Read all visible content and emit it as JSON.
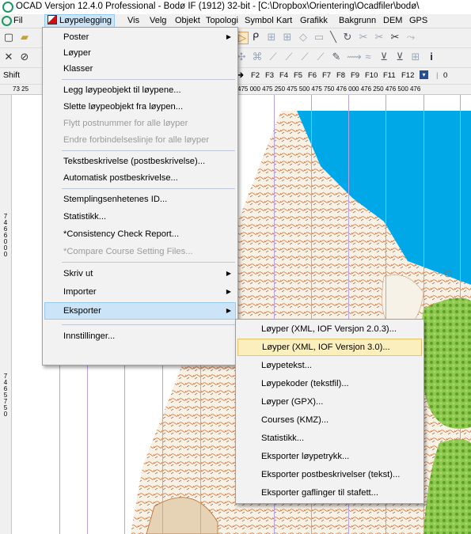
{
  "window": {
    "title": "OCAD Versjon 12.4.0  Professional - Bodø IF (1912) 32-bit - [C:\\Dropbox\\Orientering\\Ocadfiler\\bodø\\"
  },
  "menubar": {
    "items": [
      "Fil",
      "Løypelegging",
      "Vis",
      "Velg",
      "Objekt",
      "Topologi",
      "Symbol",
      "Kart",
      "Grafikk",
      "Bakgrunn",
      "DEM",
      "GPS"
    ],
    "active": "Løypelegging"
  },
  "toolbar3": {
    "shift_label": "Shift",
    "fkeys": [
      "F2",
      "F3",
      "F4",
      "F5",
      "F6",
      "F7",
      "F8",
      "F9",
      "F10",
      "F11",
      "F12"
    ],
    "zero": "0"
  },
  "ruler": {
    "top_left": "73 25",
    "top_right": "475 000 475 250 475 500 475 750 476 000 476 250 476 500 476",
    "left_1": "7466000",
    "left_2": "7465750"
  },
  "menu": {
    "items": [
      {
        "label": "Poster",
        "enabled": true,
        "submenu": true
      },
      {
        "label": "Løyper",
        "enabled": true,
        "submenu": false
      },
      {
        "label": "Klasser",
        "enabled": true,
        "submenu": false
      },
      {
        "label": "Legg løypeobjekt til løypene...",
        "enabled": true,
        "submenu": false
      },
      {
        "label": "Slette løypeobjekt fra løypen...",
        "enabled": true,
        "submenu": false
      },
      {
        "label": "Flytt postnummer for alle løyper",
        "enabled": false,
        "submenu": false
      },
      {
        "label": "Endre forbindelseslinje for alle løyper",
        "enabled": false,
        "submenu": false
      },
      {
        "label": "Tekstbeskrivelse (postbeskrivelse)...",
        "enabled": true,
        "submenu": false
      },
      {
        "label": "Automatisk postbeskrivelse...",
        "enabled": true,
        "submenu": false
      },
      {
        "label": "Stemplingsenhetenes ID...",
        "enabled": true,
        "submenu": false
      },
      {
        "label": "Statistikk...",
        "enabled": true,
        "submenu": false
      },
      {
        "label": "*Consistency Check Report...",
        "enabled": true,
        "submenu": false
      },
      {
        "label": "*Compare Course Setting Files...",
        "enabled": false,
        "submenu": false
      },
      {
        "label": "Skriv ut",
        "enabled": true,
        "submenu": true
      },
      {
        "label": "Importer",
        "enabled": true,
        "submenu": true
      },
      {
        "label": "Eksporter",
        "enabled": true,
        "submenu": true,
        "highlighted": true
      },
      {
        "label": "Innstillinger...",
        "enabled": true,
        "submenu": false
      }
    ]
  },
  "submenu": {
    "items": [
      {
        "label": "Løyper (XML, IOF Versjon 2.0.3)..."
      },
      {
        "label": "Løyper (XML, IOF Versjon 3.0)...",
        "selected": true
      },
      {
        "label": "Løypetekst..."
      },
      {
        "label": "Løypekoder (tekstfil)..."
      },
      {
        "label": "Løyper (GPX)..."
      },
      {
        "label": "Courses (KMZ)..."
      },
      {
        "label": "Statistikk..."
      },
      {
        "label": "Eksporter løypetrykk..."
      },
      {
        "label": "Eksporter postbeskrivelser (tekst)..."
      },
      {
        "label": "Eksporter gaflinger til stafett..."
      }
    ]
  },
  "colors": {
    "menu_bg": "#f2f2f2",
    "highlight": "#cce4f7",
    "selected": "#fcefbe",
    "water": "#00a8e8",
    "forest": "#7cbf3c",
    "grid_line": "#b7a2e6"
  }
}
